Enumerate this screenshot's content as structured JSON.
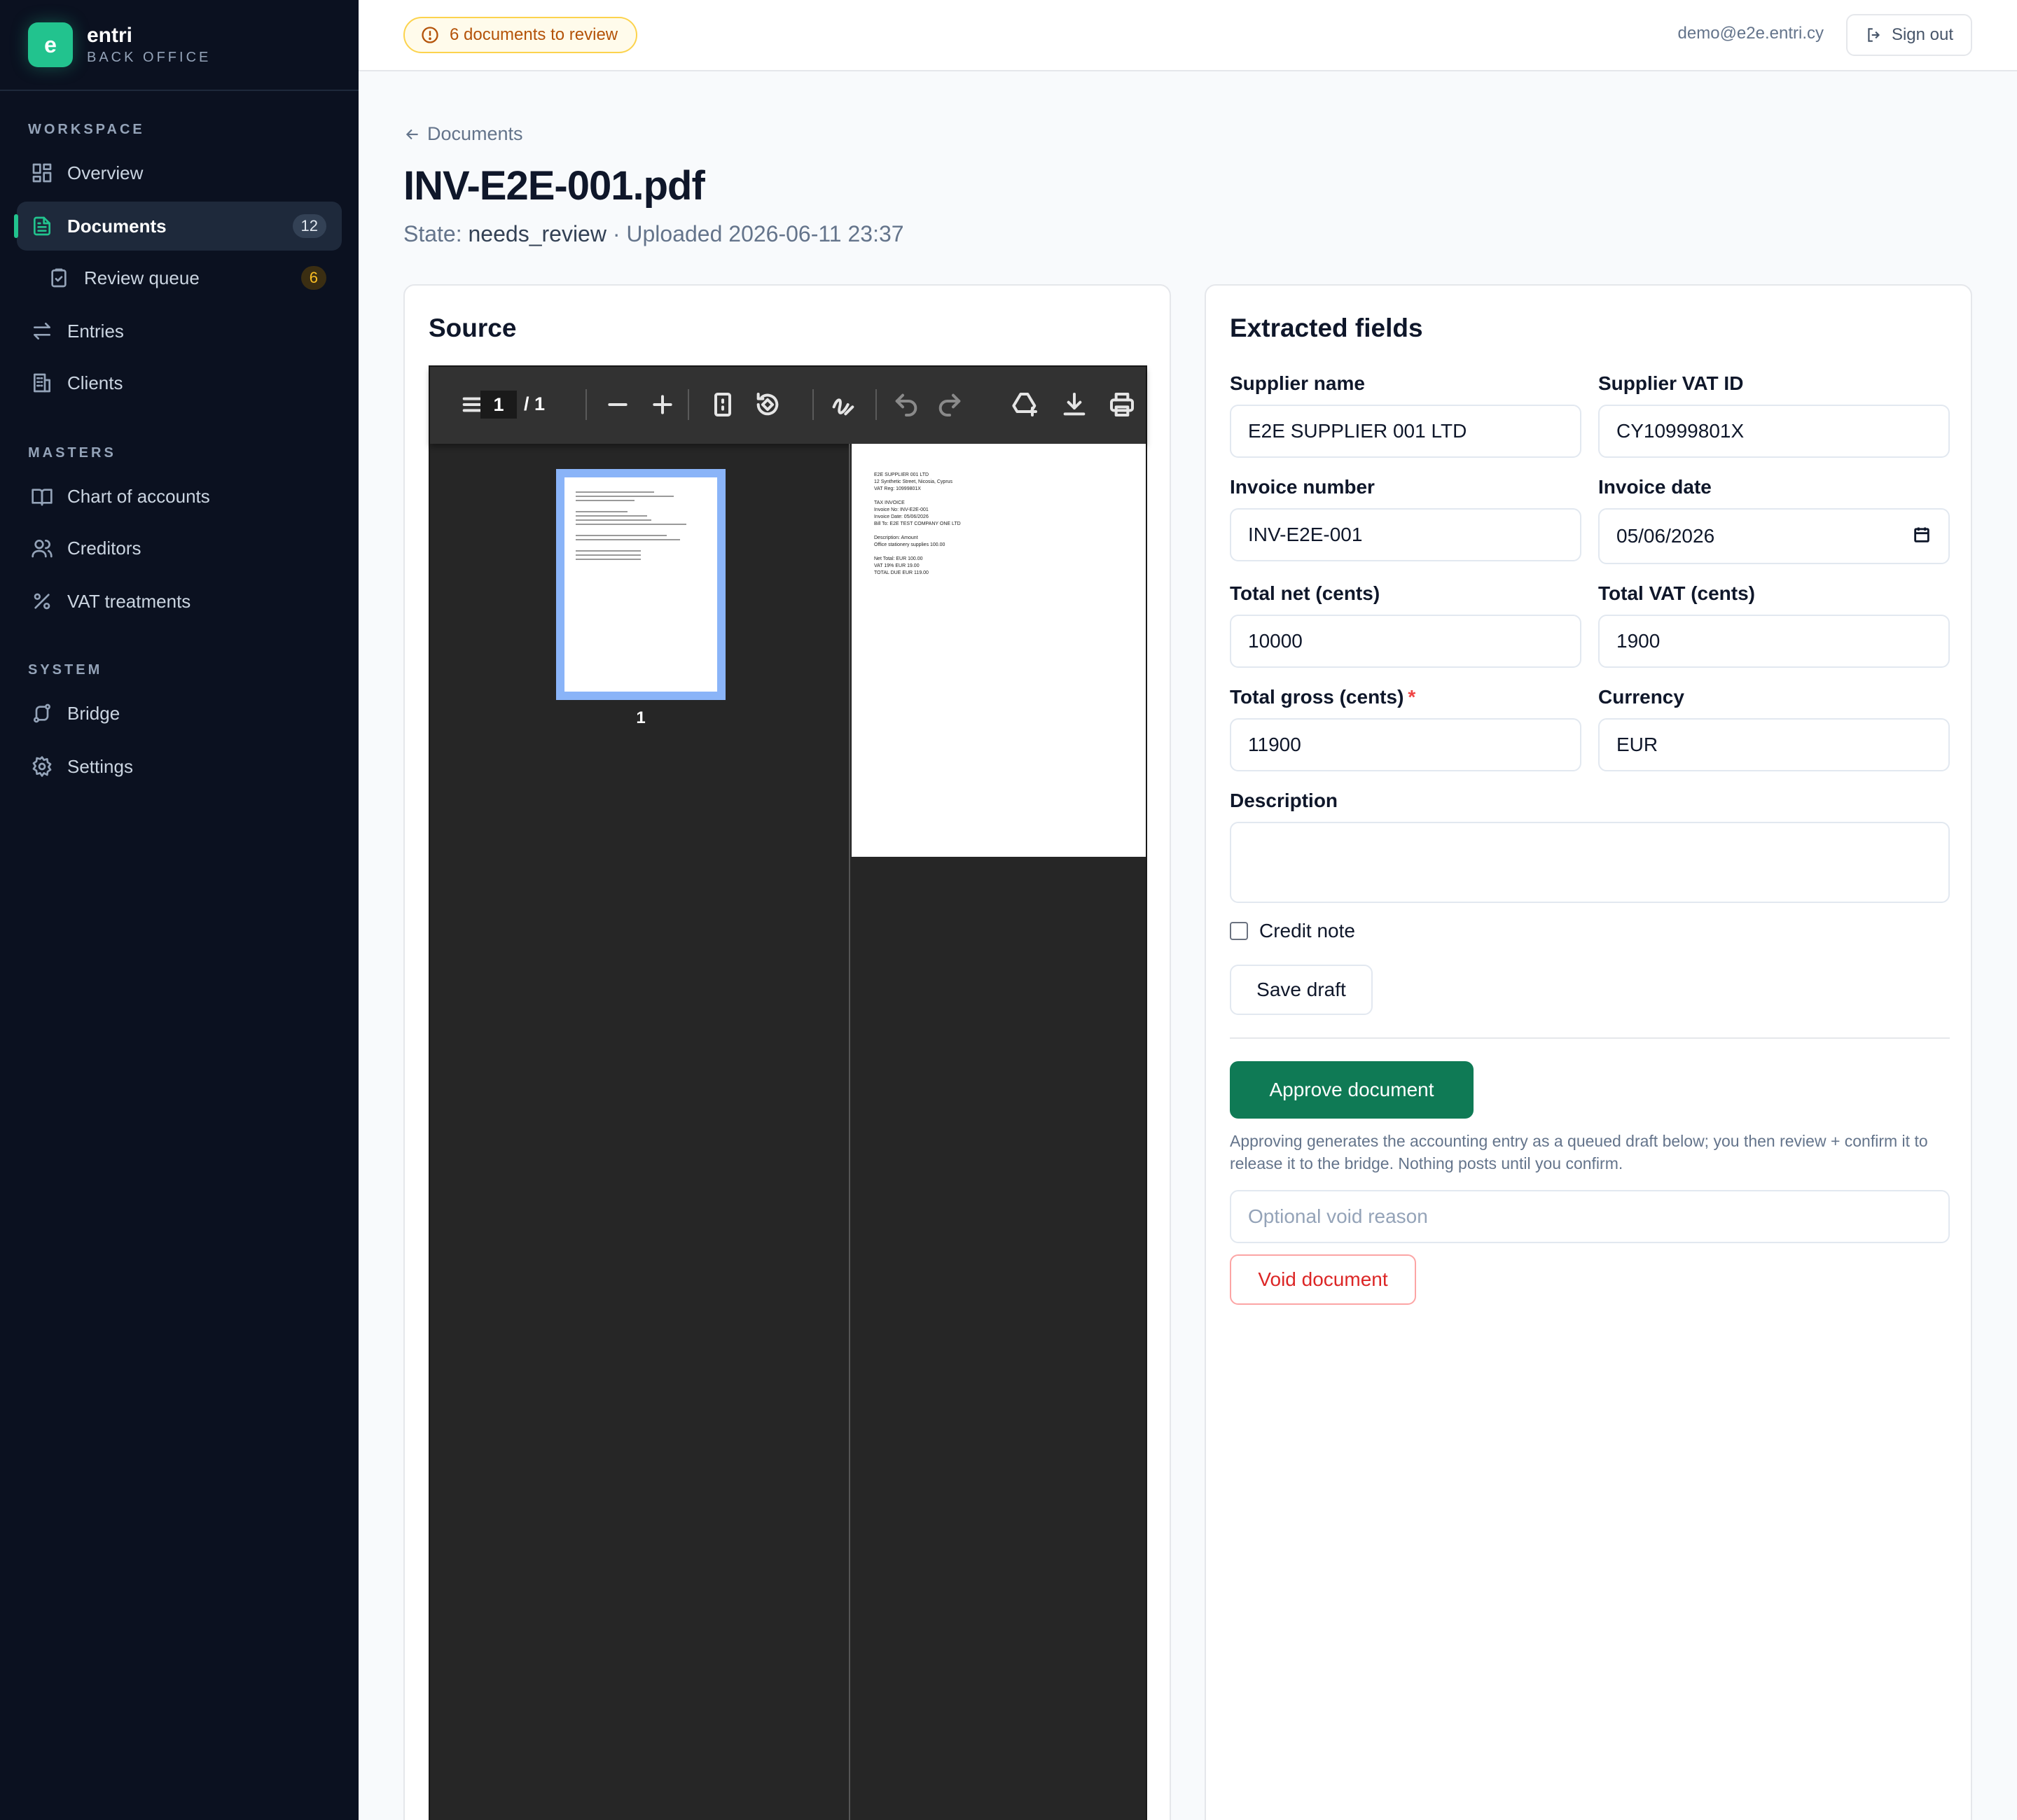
{
  "brand": {
    "logo_letter": "e",
    "name": "entri",
    "subtitle": "BACK OFFICE",
    "accent": "#22c38e"
  },
  "sidebar": {
    "sections": [
      {
        "label": "WORKSPACE"
      },
      {
        "label": "MASTERS"
      },
      {
        "label": "SYSTEM"
      }
    ],
    "items": [
      {
        "label": "Overview",
        "icon": "grid-icon"
      },
      {
        "label": "Documents",
        "icon": "document-icon",
        "count": "12",
        "active": true
      },
      {
        "label": "Review queue",
        "icon": "clipboard-check-icon",
        "count": "6"
      },
      {
        "label": "Entries",
        "icon": "arrows-exchange-icon"
      },
      {
        "label": "Clients",
        "icon": "building-icon"
      },
      {
        "label": "Chart of accounts",
        "icon": "book-open-icon"
      },
      {
        "label": "Creditors",
        "icon": "users-icon"
      },
      {
        "label": "VAT treatments",
        "icon": "percent-icon"
      },
      {
        "label": "Bridge",
        "icon": "bridge-icon"
      },
      {
        "label": "Settings",
        "icon": "gear-icon"
      }
    ]
  },
  "topbar": {
    "review_alert": "6 documents to review",
    "user_email": "demo@e2e.entri.cy",
    "signout_label": "Sign out"
  },
  "header": {
    "back_label": "Documents",
    "title": "INV-E2E-001.pdf",
    "state_prefix": "State: ",
    "state": "needs_review",
    "uploaded": " · Uploaded 2026-06-11 23:37"
  },
  "source": {
    "title": "Source",
    "viewer": {
      "page_current": "1",
      "page_total": "/ 1",
      "thumbnail_label": "1",
      "page_lines": [
        "E2E SUPPLIER 001 LTD",
        "12 Synthetic Street, Nicosia, Cyprus",
        "VAT Reg: 10999801X",
        "",
        "TAX INVOICE",
        "Invoice No: INV-E2E-001",
        "Invoice Date: 05/06/2026",
        "Bill To: E2E TEST COMPANY ONE LTD",
        "",
        "Description:                    Amount",
        "Office stationery supplies        100.00",
        "",
        "Net Total:       EUR 100.00",
        "VAT 19%          EUR  19.00",
        "TOTAL DUE        EUR 119.00"
      ]
    }
  },
  "fields": {
    "title": "Extracted fields",
    "supplier_name": {
      "label": "Supplier name",
      "value": "E2E SUPPLIER 001 LTD"
    },
    "supplier_vat": {
      "label": "Supplier VAT ID",
      "value": "CY10999801X"
    },
    "invoice_number": {
      "label": "Invoice number",
      "value": "INV-E2E-001"
    },
    "invoice_date": {
      "label": "Invoice date",
      "value": "05/06/2026"
    },
    "total_net": {
      "label": "Total net (cents)",
      "value": "10000"
    },
    "total_vat": {
      "label": "Total VAT (cents)",
      "value": "1900"
    },
    "total_gross": {
      "label": "Total gross (cents)",
      "required": "*",
      "value": "11900"
    },
    "currency": {
      "label": "Currency",
      "value": "EUR"
    },
    "description": {
      "label": "Description",
      "value": ""
    },
    "credit_note": {
      "label": "Credit note",
      "checked": false
    },
    "save_draft_label": "Save draft",
    "approve_label": "Approve document",
    "approve_help": "Approving generates the accounting entry as a queued draft below; you then review + confirm it to release it to the bridge. Nothing posts until you confirm.",
    "void_reason_placeholder": "Optional void reason",
    "void_label": "Void document",
    "colors": {
      "primary": "#0f7a55",
      "danger": "#dc2626",
      "warning": "#b45309"
    }
  }
}
